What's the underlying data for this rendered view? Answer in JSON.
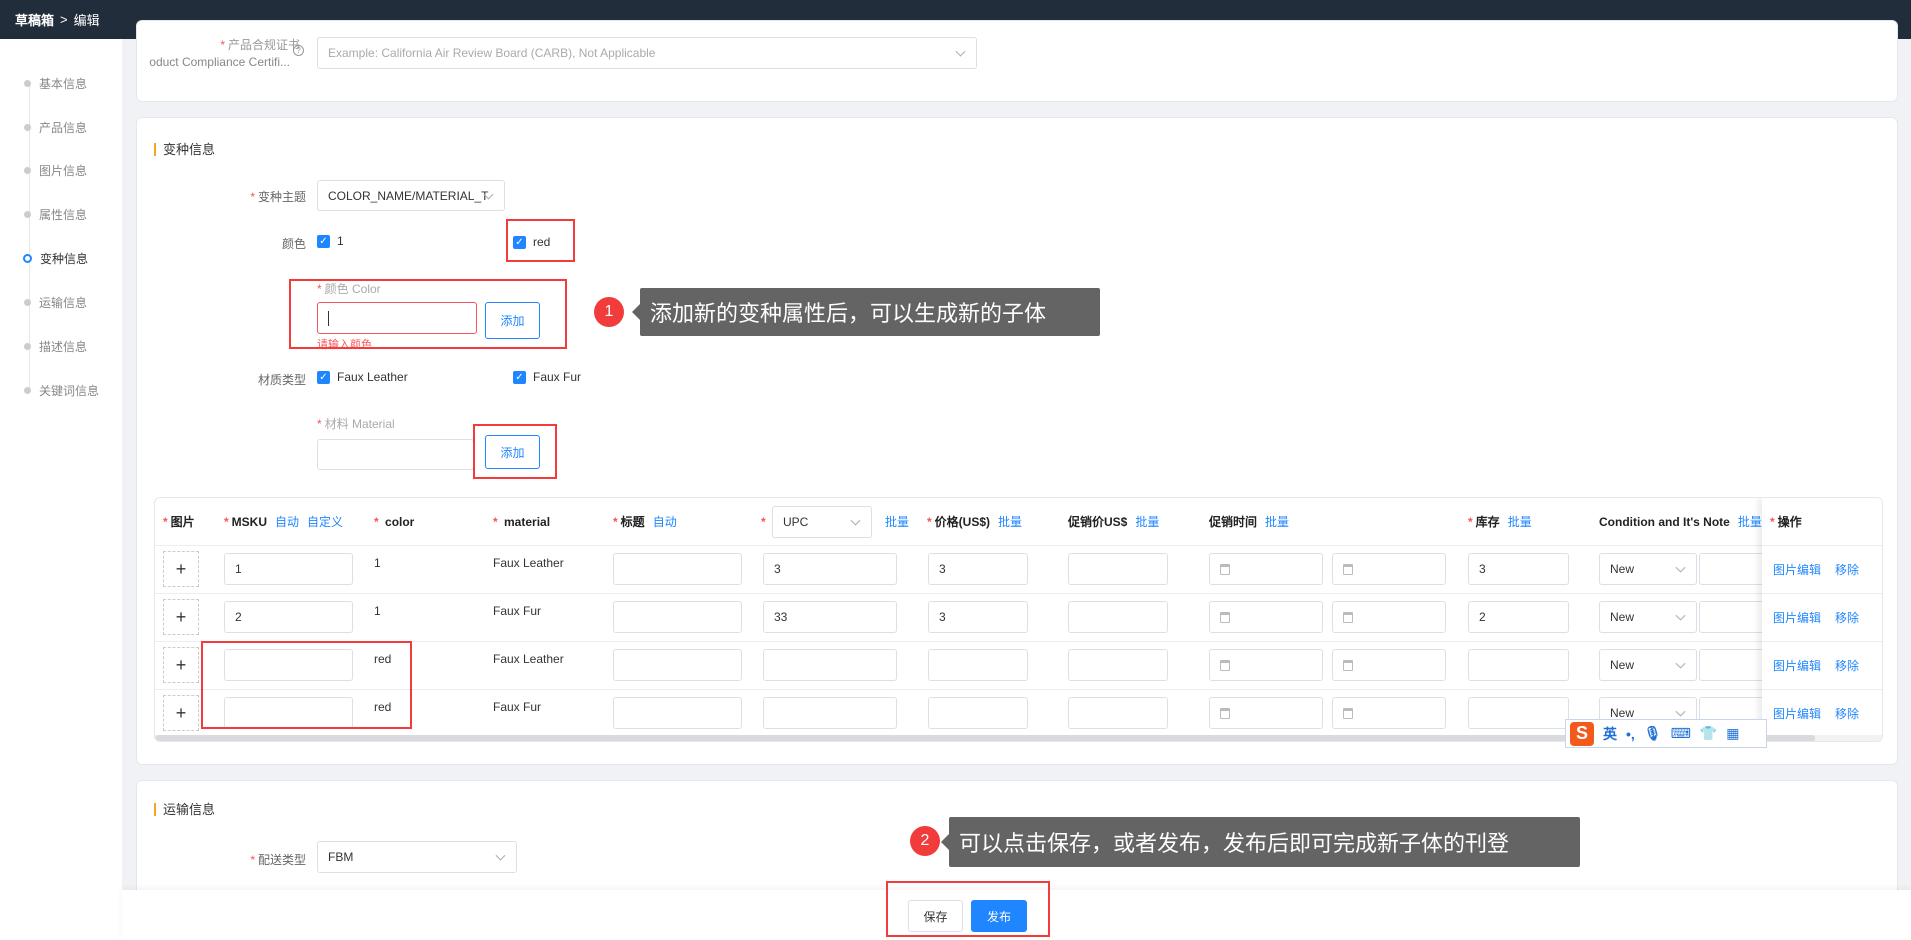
{
  "breadcrumb": {
    "root": "草稿箱",
    "separator": ">",
    "current": "编辑"
  },
  "sidenav": {
    "items": [
      {
        "label": "基本信息",
        "active": false
      },
      {
        "label": "产品信息",
        "active": false
      },
      {
        "label": "图片信息",
        "active": false
      },
      {
        "label": "属性信息",
        "active": false
      },
      {
        "label": "变种信息",
        "active": true
      },
      {
        "label": "运输信息",
        "active": false
      },
      {
        "label": "描述信息",
        "active": false
      },
      {
        "label": "关键词信息",
        "active": false
      }
    ]
  },
  "compliance": {
    "label": "产品合规证书",
    "label_en": "oduct Compliance Certifi...",
    "placeholder": "Example: California Air Review Board (CARB), Not Applicable"
  },
  "variant": {
    "title": "变种信息",
    "theme_label": "变种主题",
    "theme_value": "COLOR_NAME/MATERIAL_T",
    "color_label": "颜色",
    "colors": [
      "1",
      "red"
    ],
    "color_input_label": "颜色 Color",
    "color_input_value": "",
    "color_error": "请输入颜色",
    "add_label": "添加",
    "material_label": "材质类型",
    "materials": [
      "Faux Leather",
      "Faux Fur"
    ],
    "material_input_label": "材料 Material",
    "material_input_value": ""
  },
  "table": {
    "headers": {
      "image": "图片",
      "msku": "MSKU",
      "auto": "自动",
      "custom": "自定义",
      "color": "color",
      "material": "material",
      "title": "标题",
      "upc": "UPC",
      "batch": "批量",
      "price": "价格(US$)",
      "promo_price": "促销价US$",
      "promo_time": "促销时间",
      "stock": "库存",
      "condition": "Condition and It's Note",
      "action": "操作"
    },
    "rows": [
      {
        "msku": "1",
        "color": "1",
        "material": "Faux Leather",
        "title": "",
        "upc": "3",
        "price": "3",
        "promo": "",
        "stock": "3",
        "condition": "New"
      },
      {
        "msku": "2",
        "color": "1",
        "material": "Faux Fur",
        "title": "",
        "upc": "33",
        "price": "3",
        "promo": "",
        "stock": "2",
        "condition": "New"
      },
      {
        "msku": "",
        "color": "red",
        "material": "Faux Leather",
        "title": "",
        "upc": "",
        "price": "",
        "promo": "",
        "stock": "",
        "condition": "New"
      },
      {
        "msku": "",
        "color": "red",
        "material": "Faux Fur",
        "title": "",
        "upc": "",
        "price": "",
        "promo": "",
        "stock": "",
        "condition": "New"
      }
    ],
    "action_edit": "图片编辑",
    "action_remove": "移除"
  },
  "shipping": {
    "title": "运输信息",
    "type_label": "配送类型",
    "type_value": "FBM"
  },
  "callouts": [
    {
      "num": "1",
      "text": "添加新的变种属性后，可以生成新的子体"
    },
    {
      "num": "2",
      "text": "可以点击保存，或者发布，发布后即可完成新子体的刊登"
    }
  ],
  "ime": {
    "logo": "S",
    "lang": "英",
    "punct": "•,"
  },
  "footer": {
    "save": "保存",
    "publish": "发布"
  },
  "colors": {
    "primary": "#1f86ff",
    "annotation": "#f23b3b",
    "topbar": "#222d3c"
  }
}
